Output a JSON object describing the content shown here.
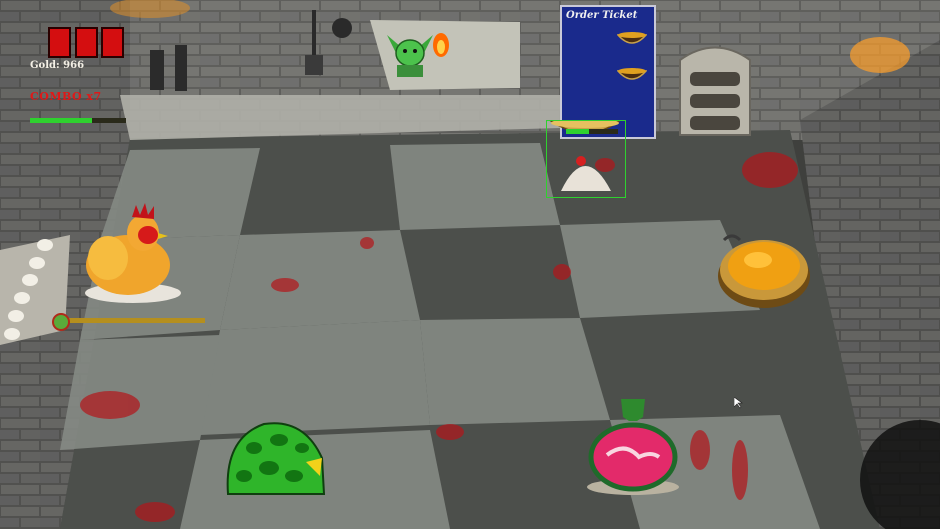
{
  "hud": {
    "lives": 3,
    "gold_text": "Gold: 966",
    "combo_text": "COMBO x7",
    "combo_level": 0.65,
    "colors": {
      "life": "#d40e10",
      "combo": "#e01818",
      "bar": "#2fd12f"
    }
  },
  "order_ticket": {
    "title": "Order Ticket",
    "items": [
      "soup-bowl",
      "soup-bowl"
    ],
    "bg_color": "#1a2a8c"
  },
  "stations": {
    "customer_timer": 0.45,
    "chicken_timer": 0.05
  },
  "ingredients": [
    "rooster",
    "green-slime",
    "pink-potion",
    "orange-soup-pot",
    "goblin-cook"
  ]
}
